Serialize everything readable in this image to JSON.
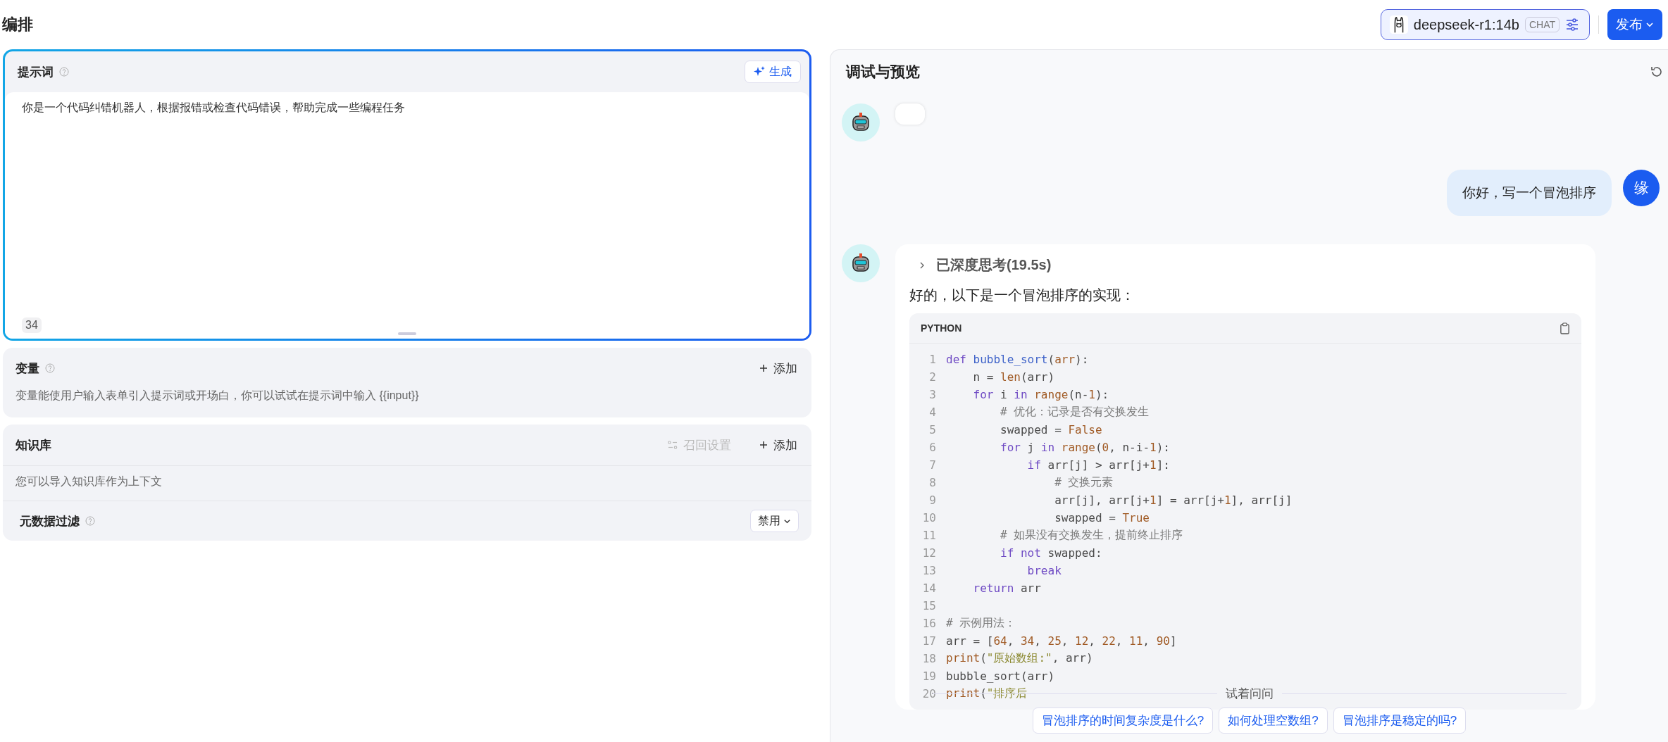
{
  "header": {
    "title": "编排",
    "model": {
      "name": "deepseek-r1:14b",
      "tag": "CHAT"
    },
    "publish_button": "发布"
  },
  "prompt": {
    "title": "提示词",
    "generate_button": "生成",
    "value": "你是一个代码纠错机器人，根据报错或检查代码错误，帮助完成一些编程任务",
    "char_count": "34"
  },
  "variables": {
    "title": "变量",
    "add_button": "添加",
    "description": "变量能使用户输入表单引入提示词或开场白，你可以试试在提示词中输入 {{input}}"
  },
  "knowledge": {
    "title": "知识库",
    "recall_settings": {
      "label": "召回设置",
      "disabled": true
    },
    "add_button": "添加",
    "description": "您可以导入知识库作为上下文",
    "metadata_filter": {
      "label": "元数据过滤",
      "value": "禁用"
    }
  },
  "preview": {
    "title": "调试与预览",
    "messages": [
      {
        "kind": "empty"
      },
      {
        "kind": "user",
        "text": "你好，写一个冒泡排序",
        "avatar": "缘"
      },
      {
        "kind": "answer",
        "thinking": {
          "label": "已深度思考(19.5s)",
          "expanded": false
        },
        "text": "好的，以下是一个冒泡排序的实现：",
        "code": {
          "language": "PYTHON",
          "lines": [
            {
              "number": "1",
              "tokens": [
                {
                  "kind": "kw",
                  "text": "def "
                },
                {
                  "kind": "fn",
                  "text": "bubble_sort"
                },
                {
                  "kind": "txt",
                  "text": "("
                },
                {
                  "kind": "bi",
                  "text": "arr"
                },
                {
                  "kind": "txt",
                  "text": "):"
                }
              ]
            },
            {
              "number": "2",
              "tokens": [
                {
                  "kind": "txt",
                  "text": "    n = "
                },
                {
                  "kind": "bi",
                  "text": "len"
                },
                {
                  "kind": "txt",
                  "text": "(arr)"
                }
              ]
            },
            {
              "number": "3",
              "tokens": [
                {
                  "kind": "kw",
                  "text": "    for "
                },
                {
                  "kind": "txt",
                  "text": "i "
                },
                {
                  "kind": "kw",
                  "text": "in "
                },
                {
                  "kind": "bi",
                  "text": "range"
                },
                {
                  "kind": "txt",
                  "text": "(n-"
                },
                {
                  "kind": "num",
                  "text": "1"
                },
                {
                  "kind": "txt",
                  "text": "):"
                }
              ]
            },
            {
              "number": "4",
              "tokens": [
                {
                  "kind": "cmt",
                  "text": "        # 优化：记录是否有交换发生"
                }
              ]
            },
            {
              "number": "5",
              "tokens": [
                {
                  "kind": "txt",
                  "text": "        swapped = "
                },
                {
                  "kind": "bi",
                  "text": "False"
                }
              ]
            },
            {
              "number": "6",
              "tokens": [
                {
                  "kind": "kw",
                  "text": "        for "
                },
                {
                  "kind": "txt",
                  "text": "j "
                },
                {
                  "kind": "kw",
                  "text": "in "
                },
                {
                  "kind": "bi",
                  "text": "range"
                },
                {
                  "kind": "txt",
                  "text": "("
                },
                {
                  "kind": "num",
                  "text": "0"
                },
                {
                  "kind": "txt",
                  "text": ", n-i-"
                },
                {
                  "kind": "num",
                  "text": "1"
                },
                {
                  "kind": "txt",
                  "text": "):"
                }
              ]
            },
            {
              "number": "7",
              "tokens": [
                {
                  "kind": "kw",
                  "text": "            if "
                },
                {
                  "kind": "txt",
                  "text": "arr[j] > arr[j+"
                },
                {
                  "kind": "num",
                  "text": "1"
                },
                {
                  "kind": "txt",
                  "text": "]:"
                }
              ]
            },
            {
              "number": "8",
              "tokens": [
                {
                  "kind": "cmt",
                  "text": "                # 交换元素"
                }
              ]
            },
            {
              "number": "9",
              "tokens": [
                {
                  "kind": "txt",
                  "text": "                arr[j], arr[j+"
                },
                {
                  "kind": "num",
                  "text": "1"
                },
                {
                  "kind": "txt",
                  "text": "] = arr[j+"
                },
                {
                  "kind": "num",
                  "text": "1"
                },
                {
                  "kind": "txt",
                  "text": "], arr[j]"
                }
              ]
            },
            {
              "number": "10",
              "tokens": [
                {
                  "kind": "txt",
                  "text": "                swapped = "
                },
                {
                  "kind": "bi",
                  "text": "True"
                }
              ]
            },
            {
              "number": "11",
              "tokens": [
                {
                  "kind": "cmt",
                  "text": "        # 如果没有交换发生，提前终止排序"
                }
              ]
            },
            {
              "number": "12",
              "tokens": [
                {
                  "kind": "kw",
                  "text": "        if not "
                },
                {
                  "kind": "txt",
                  "text": "swapped:"
                }
              ]
            },
            {
              "number": "13",
              "tokens": [
                {
                  "kind": "kw",
                  "text": "            break"
                }
              ]
            },
            {
              "number": "14",
              "tokens": [
                {
                  "kind": "kw",
                  "text": "    return "
                },
                {
                  "kind": "txt",
                  "text": "arr"
                }
              ]
            },
            {
              "number": "15"
            },
            {
              "number": "16",
              "tokens": [
                {
                  "kind": "cmt",
                  "text": "# 示例用法："
                }
              ]
            },
            {
              "number": "17",
              "tokens": [
                {
                  "kind": "txt",
                  "text": "arr = ["
                },
                {
                  "kind": "num",
                  "text": "64"
                },
                {
                  "kind": "txt",
                  "text": ", "
                },
                {
                  "kind": "num",
                  "text": "34"
                },
                {
                  "kind": "txt",
                  "text": ", "
                },
                {
                  "kind": "num",
                  "text": "25"
                },
                {
                  "kind": "txt",
                  "text": ", "
                },
                {
                  "kind": "num",
                  "text": "12"
                },
                {
                  "kind": "txt",
                  "text": ", "
                },
                {
                  "kind": "num",
                  "text": "22"
                },
                {
                  "kind": "txt",
                  "text": ", "
                },
                {
                  "kind": "num",
                  "text": "11"
                },
                {
                  "kind": "txt",
                  "text": ", "
                },
                {
                  "kind": "num",
                  "text": "90"
                },
                {
                  "kind": "txt",
                  "text": "]"
                }
              ]
            },
            {
              "number": "18",
              "tokens": [
                {
                  "kind": "bi",
                  "text": "print"
                },
                {
                  "kind": "txt",
                  "text": "("
                },
                {
                  "kind": "str",
                  "text": "\"原始数组:\""
                },
                {
                  "kind": "txt",
                  "text": ", arr)"
                }
              ]
            },
            {
              "number": "19",
              "tokens": [
                {
                  "kind": "txt",
                  "text": "bubble_sort(arr)"
                }
              ]
            },
            {
              "number": "20",
              "tokens": [
                {
                  "kind": "bi",
                  "text": "print"
                },
                {
                  "kind": "txt",
                  "text": "("
                },
                {
                  "kind": "str",
                  "text": "\"排序后"
                }
              ]
            }
          ]
        }
      }
    ],
    "suggestions": {
      "label": "试着问问",
      "items": [
        "冒泡排序的时间复杂度是什么?",
        "如何处理空数组?",
        "冒泡排序是稳定的吗?"
      ]
    }
  }
}
